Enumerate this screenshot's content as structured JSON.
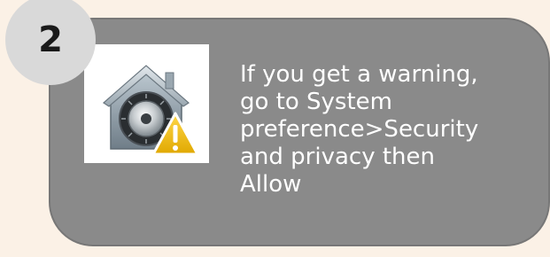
{
  "step": {
    "number": "2"
  },
  "instruction": {
    "text": "If you get a warning,\ngo to System\npreference>Security\nand privacy then\nAllow"
  },
  "icons": {
    "gatekeeper": "gatekeeper-house-vault-icon",
    "warning": "warning-triangle-icon"
  },
  "colors": {
    "page_background": "#fbf1e6",
    "card_background": "#8a8a8a",
    "badge_background": "#d9d9d9",
    "text": "#ffffff",
    "warning": "#f5c518"
  }
}
